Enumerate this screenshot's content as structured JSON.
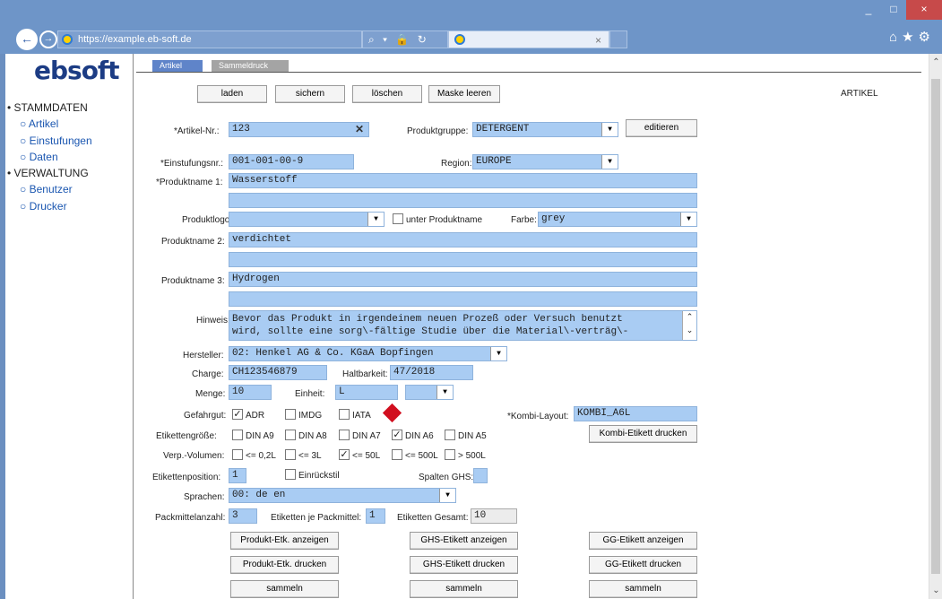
{
  "browser": {
    "url": "https://example.eb-soft.de",
    "window_controls": [
      "_",
      "□",
      "×"
    ],
    "tab_close": "×",
    "addr_icons": "⌕ ▾ 🔒 ↻"
  },
  "logo": "ebsoft",
  "sidebar": {
    "stammdaten": "STAMMDATEN",
    "items1": [
      "Artikel",
      "Einstufungen",
      "Daten"
    ],
    "verwaltung": "VERWALTUNG",
    "items2": [
      "Benutzer",
      "Drucker"
    ]
  },
  "tabs": {
    "artikel": "Artikel",
    "sammeldruck": "Sammeldruck"
  },
  "toolbar": {
    "laden": "laden",
    "sichern": "sichern",
    "loeschen": "löschen",
    "maske": "Maske leeren",
    "page_label": "ARTIKEL"
  },
  "form": {
    "artikelnr_label": "*Artikel-Nr.:",
    "artikelnr": "123",
    "produktgruppe_label": "Produktgruppe:",
    "produktgruppe": "DETERGENT",
    "editieren": "editieren",
    "einstufung_label": "*Einstufungsnr.:",
    "einstufung": "001-001-00-9",
    "region_label": "Region:",
    "region": "EUROPE",
    "produktname1_label": "*Produktname 1:",
    "produktname1": "Wasserstoff",
    "produktname1b": "",
    "produktlogo_label": "Produktlogo:",
    "produktlogo": "",
    "unter_label": "unter Produktname",
    "farbe_label": "Farbe:",
    "farbe": "grey",
    "produktname2_label": "Produktname 2:",
    "produktname2": "verdichtet",
    "produktname2b": "",
    "produktname3_label": "Produktname 3:",
    "produktname3": "Hydrogen",
    "produktname3b": "",
    "hinweis_label": "Hinweis:",
    "hinweis1": "Bevor das Produkt in irgendeinem neuen Prozeß oder Versuch benutzt",
    "hinweis2": "wird, sollte eine sorg\\-fältige Studie über die Material\\-verträg\\-",
    "hersteller_label": "Hersteller:",
    "hersteller": "02: Henkel AG & Co. KGaA Bopfingen",
    "charge_label": "Charge:",
    "charge": "CH123546879",
    "haltbarkeit_label": "Haltbarkeit:",
    "haltbarkeit": "47/2018",
    "menge_label": "Menge:",
    "menge": "10",
    "einheit_label": "Einheit:",
    "einheit": "L",
    "einheit2": "",
    "gefahrgut_label": "Gefahrgut:",
    "adr": "ADR",
    "imdg": "IMDG",
    "iata": "IATA",
    "kombi_label": "*Kombi-Layout:",
    "kombi": "KOMBI_A6L",
    "kombi_btn": "Kombi-Etikett drucken",
    "etikettengroesse_label": "Etikettengröße:",
    "din": [
      "DIN A9",
      "DIN A8",
      "DIN A7",
      "DIN A6",
      "DIN A5"
    ],
    "verp_label": "Verp.-Volumen:",
    "vol": [
      "<= 0,2L",
      "<= 3L",
      "<= 50L",
      "<= 500L",
      "> 500L"
    ],
    "etikettenpos_label": "Etikettenposition:",
    "etikettenpos": "1",
    "einrueck_label": "Einrückstil",
    "spalten_label": "Spalten GHS:",
    "spalten": "",
    "sprachen_label": "Sprachen:",
    "sprachen": "00: de en",
    "packmittel_label": "Packmittelanzahl:",
    "packmittel": "3",
    "etjepack_label": "Etiketten je Packmittel:",
    "etjepack": "1",
    "etgesamt_label": "Etiketten Gesamt:",
    "etgesamt": "10"
  },
  "buttons": {
    "prod_anzeigen": "Produkt-Etk. anzeigen",
    "ghs_anzeigen": "GHS-Etikett anzeigen",
    "gg_anzeigen": "GG-Etikett anzeigen",
    "prod_drucken": "Produkt-Etk. drucken",
    "ghs_drucken": "GHS-Etikett drucken",
    "gg_drucken": "GG-Etikett drucken",
    "sammeln": "sammeln"
  },
  "colors": {
    "field": "#a9ccf3",
    "chrome": "#6e95c8",
    "tab_active": "#5f84c9",
    "hazard": "#d10f1f"
  }
}
